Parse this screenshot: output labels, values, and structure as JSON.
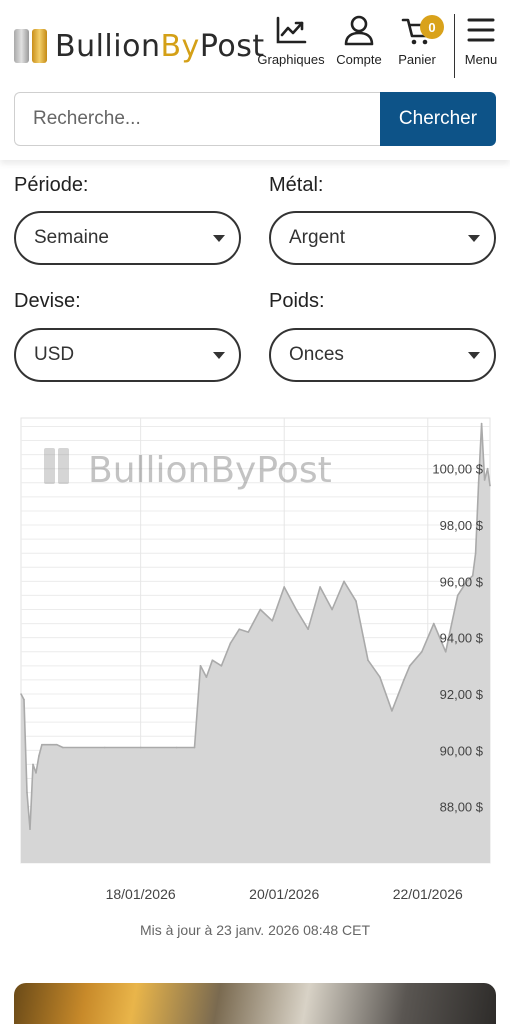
{
  "header": {
    "logo_text_a": "Bullion",
    "logo_text_b": "By",
    "logo_text_c": "Post",
    "nav": {
      "graph_label": "Graphiques",
      "account_label": "Compte",
      "cart_label": "Panier",
      "cart_count": "0",
      "menu_label": "Menu"
    },
    "search": {
      "placeholder": "Recherche...",
      "button_label": "Chercher"
    }
  },
  "filters": {
    "period": {
      "label": "Période:",
      "value": "Semaine"
    },
    "metal": {
      "label": "Métal:",
      "value": "Argent"
    },
    "currency": {
      "label": "Devise:",
      "value": "USD"
    },
    "weight": {
      "label": "Poids:",
      "value": "Onces"
    }
  },
  "chart_data": {
    "type": "area",
    "title": "",
    "xlabel": "",
    "ylabel": "",
    "ylim": [
      86.0,
      101.8
    ],
    "xlim": [
      "2026-01-16T20:00",
      "2026-01-23T08:48"
    ],
    "x_ticks": [
      "18/01/2026",
      "20/01/2026",
      "22/01/2026"
    ],
    "y_ticks": [
      "88,00 $",
      "90,00 $",
      "92,00 $",
      "94,00 $",
      "96,00 $",
      "98,00 $",
      "100,00 $"
    ],
    "y_tick_values": [
      88,
      90,
      92,
      94,
      96,
      98,
      100
    ],
    "grid": true,
    "watermark": "BullionByPost",
    "series": [
      {
        "color": "#aaaaaa",
        "fill": "#d6d6d6",
        "x": [
          "2026-01-16T20:00",
          "2026-01-16T21:00",
          "2026-01-16T22:00",
          "2026-01-16T23:00",
          "2026-01-17T00:00",
          "2026-01-17T01:00",
          "2026-01-17T02:00",
          "2026-01-17T03:00",
          "2026-01-17T04:00",
          "2026-01-17T06:00",
          "2026-01-17T08:00",
          "2026-01-17T10:00",
          "2026-01-18T00:00",
          "2026-01-18T12:00",
          "2026-01-19T00:00",
          "2026-01-19T06:00",
          "2026-01-19T08:00",
          "2026-01-19T10:00",
          "2026-01-19T12:00",
          "2026-01-19T15:00",
          "2026-01-19T18:00",
          "2026-01-19T21:00",
          "2026-01-20T00:00",
          "2026-01-20T04:00",
          "2026-01-20T08:00",
          "2026-01-20T12:00",
          "2026-01-20T16:00",
          "2026-01-20T20:00",
          "2026-01-21T00:00",
          "2026-01-21T04:00",
          "2026-01-21T08:00",
          "2026-01-21T12:00",
          "2026-01-21T16:00",
          "2026-01-21T20:00",
          "2026-01-22T00:00",
          "2026-01-22T04:00",
          "2026-01-22T06:00",
          "2026-01-22T10:00",
          "2026-01-22T14:00",
          "2026-01-22T18:00",
          "2026-01-22T22:00",
          "2026-01-23T01:00",
          "2026-01-23T03:00",
          "2026-01-23T04:00",
          "2026-01-23T05:00",
          "2026-01-23T06:00",
          "2026-01-23T07:00",
          "2026-01-23T08:00",
          "2026-01-23T08:48"
        ],
        "values": [
          92.0,
          91.8,
          88.5,
          87.2,
          89.5,
          89.2,
          89.8,
          90.2,
          90.2,
          90.2,
          90.2,
          90.1,
          90.1,
          90.1,
          90.1,
          90.1,
          93.0,
          92.6,
          93.2,
          93.0,
          93.8,
          94.3,
          94.2,
          95.0,
          94.6,
          95.8,
          95.0,
          94.3,
          95.8,
          95.0,
          96.0,
          95.3,
          93.2,
          92.6,
          91.4,
          92.5,
          93.0,
          93.5,
          94.5,
          93.5,
          95.5,
          96.0,
          96.2,
          97.0,
          99.5,
          101.6,
          99.6,
          100.0,
          99.4
        ]
      }
    ]
  },
  "footnote": "Mis à jour à 23 janv. 2026 08:48 CET"
}
